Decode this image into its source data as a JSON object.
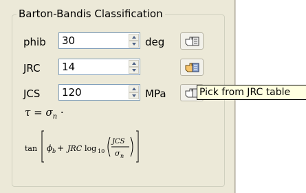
{
  "group": {
    "title": "Barton-Bandis Classification"
  },
  "rows": [
    {
      "label": "phib",
      "value": "30",
      "unit": "deg"
    },
    {
      "label": "JRC",
      "value": "14",
      "unit": ""
    },
    {
      "label": "JCS",
      "value": "120",
      "unit": "MPa"
    }
  ],
  "tooltip": {
    "text": "Pick from JRC table"
  },
  "formula": {
    "tau": "τ",
    "eq": " = ",
    "sigma": "σ",
    "n": "n",
    "dot": " ·",
    "tan": "tan",
    "phi": "ϕ",
    "b": "b",
    "plus": " +",
    "jrc": "JRC",
    "log": "log",
    "ten": "10",
    "jcs": "JCS"
  },
  "icons": {
    "pick_button_icon": "hand-pointer-icon"
  }
}
